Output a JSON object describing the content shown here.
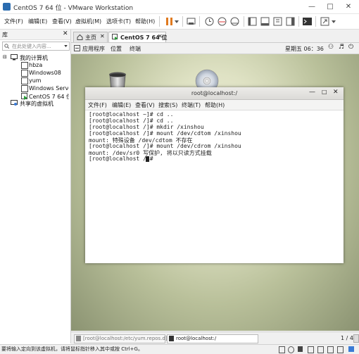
{
  "window": {
    "title": "CentOS 7 64 位 - VMware Workstation"
  },
  "menubar": {
    "items": [
      {
        "label": "文件(F)"
      },
      {
        "label": "编辑(E)"
      },
      {
        "label": "查看(V)"
      },
      {
        "label": "虚拟机(M)"
      },
      {
        "label": "选项卡(T)"
      },
      {
        "label": "帮助(H)"
      }
    ]
  },
  "library": {
    "title": "库",
    "search_placeholder": "在此处键入内容...",
    "root_label": "我的计算机",
    "vms": [
      {
        "label": "hbza"
      },
      {
        "label": "Windows08"
      },
      {
        "label": "yum"
      },
      {
        "label": "Windows Server"
      },
      {
        "label": "CentOS 7 64 位"
      }
    ],
    "shared_label": "共享的虚拟机"
  },
  "tabs": [
    {
      "label": "主页"
    },
    {
      "label": "CentOS 7 64 位"
    }
  ],
  "gnome": {
    "apps": "应用程序",
    "places": "位置",
    "terminal": "终端",
    "clock": "星期五 06：36"
  },
  "terminal": {
    "title": "root@localhost:/",
    "menu": [
      {
        "label": "文件(F)"
      },
      {
        "label": "编辑(E)"
      },
      {
        "label": "查看(V)"
      },
      {
        "label": "搜索(S)"
      },
      {
        "label": "终端(T)"
      },
      {
        "label": "帮助(H)"
      }
    ],
    "lines": [
      "[root@localhost ~]# cd ..",
      "[root@localhost /]# cd ..",
      "[root@localhost /]# mkdir /xinshou",
      "[root@localhost /]# mount /dev/cdtom /xinshou",
      "mount: 特殊设备 /dev/cdtom 不存在",
      "[root@localhost /]# mount /dev/cdrom /xinshou",
      "mount: /dev/sr0 写保护, 将以只读方式挂载",
      "[root@localhost /]# "
    ]
  },
  "vmstatus": {
    "task1": "[root@localhost:/etc/yum.repos.d]",
    "task2": "root@localhost:/",
    "page": "1 / 4"
  },
  "statusbar": {
    "text": "要将输入定向到该虚拟机，请将鼠标指针移入其中或按 Ctrl+G。"
  }
}
